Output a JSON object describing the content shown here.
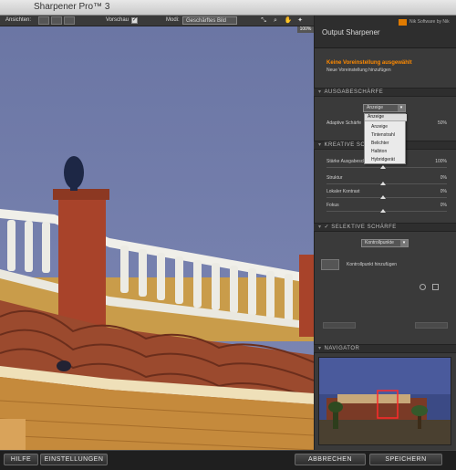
{
  "app": {
    "title": "Sharpener Pro™ 3"
  },
  "toolbar": {
    "ansichten_label": "Ansichten:",
    "vorschau_label": "Vorschau",
    "modus_label": "Modi:",
    "modus_value": "Geschärftes Bild",
    "zoom": "100%"
  },
  "panel": {
    "title": "Output Sharpener",
    "logo_text": "Nik Software by Nik",
    "preset_title": "Keine Voreinstellung ausgewählt",
    "preset_add": "Neue Voreinstellung hinzufügen",
    "section_ausgabe": "AUSGABESCHÄRFE",
    "display_select": "Anzeige",
    "adaptive_label": "Adaptive Schärfe",
    "adaptive_value": "50%",
    "section_kreativ": "KREATIVE SC",
    "staerke_label": "Stärke Ausgabeschärfe",
    "staerke_value": "100%",
    "struktur_label": "Struktur",
    "struktur_value": "0%",
    "lokaler_label": "Lokaler Kontrast",
    "lokaler_value": "0%",
    "fokus_label": "Fokus",
    "fokus_value": "0%",
    "section_selektiv": "SELEKTIVE SCHÄRFE",
    "kontroll_select": "Kontrollpunkte",
    "kontroll_add": "Kontrollpunkt hinzufügen",
    "section_navigator": "NAVIGATOR"
  },
  "display_menu": {
    "selected": "Anzeige",
    "options": [
      "Anzeige",
      "Tintenstrahl",
      "Belichter",
      "Halbton",
      "Hybridgerät"
    ]
  },
  "footer": {
    "hilfe": "HILFE",
    "einstellungen": "EINSTELLUNGEN",
    "abbrechen": "ABBRECHEN",
    "speichern": "SPEICHERN"
  }
}
